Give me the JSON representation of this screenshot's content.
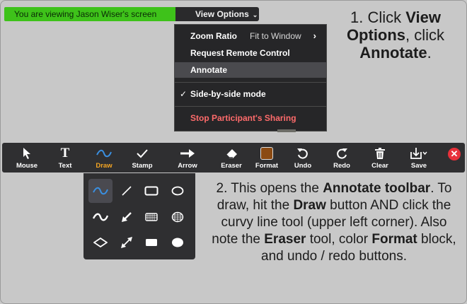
{
  "viewing_banner": "You are viewing Jason Wiser's screen",
  "view_options": {
    "label": "View Options",
    "chevron": "⌄"
  },
  "menu": {
    "zoom_ratio": {
      "label": "Zoom Ratio",
      "value": "Fit to Window",
      "arrow": "›"
    },
    "request_remote_control": "Request Remote Control",
    "annotate": "Annotate",
    "side_by_side": {
      "check": "✓",
      "label": "Side-by-side mode"
    },
    "stop_sharing": "Stop Participant's Sharing"
  },
  "step1": {
    "num": "1.",
    "pre": "Click",
    "b1": "View",
    "b2": "Options",
    "mid": ", click",
    "b3": "Annotate",
    "end": "."
  },
  "toolbar": {
    "mouse": "Mouse",
    "text": "Text",
    "text_glyph": "T",
    "draw": "Draw",
    "stamp": "Stamp",
    "arrow": "Arrow",
    "eraser": "Eraser",
    "format": "Format",
    "undo": "Undo",
    "redo": "Redo",
    "clear": "Clear",
    "save": "Save",
    "close_glyph": "✕"
  },
  "colors": {
    "active_tool": "#f5a623",
    "format_swatch": "#8b4a12",
    "banner_green": "#3ec21a",
    "close_red": "#e8303a",
    "danger_text": "#ff6b6b"
  },
  "draw_panel_icons": [
    "curvy-line-icon",
    "line-icon",
    "rectangle-outline-icon",
    "ellipse-outline-icon",
    "wavy-line-icon",
    "arrow-icon",
    "rectangle-hatched-icon",
    "ellipse-hatched-icon",
    "diamond-outline-icon",
    "double-arrow-icon",
    "rectangle-filled-icon",
    "ellipse-filled-icon"
  ],
  "step2": {
    "s1": "2. This opens the ",
    "b1": "Annotate",
    "s2": " ",
    "b2": "toolbar",
    "s3": ". To draw, hit the ",
    "b3": "Draw",
    "s4": " button AND click the curvy line tool (upper left corner). Also note the ",
    "b4": "Eraser",
    "s5": " tool, color ",
    "b5": "Format",
    "s6": " block, and undo / redo buttons."
  }
}
